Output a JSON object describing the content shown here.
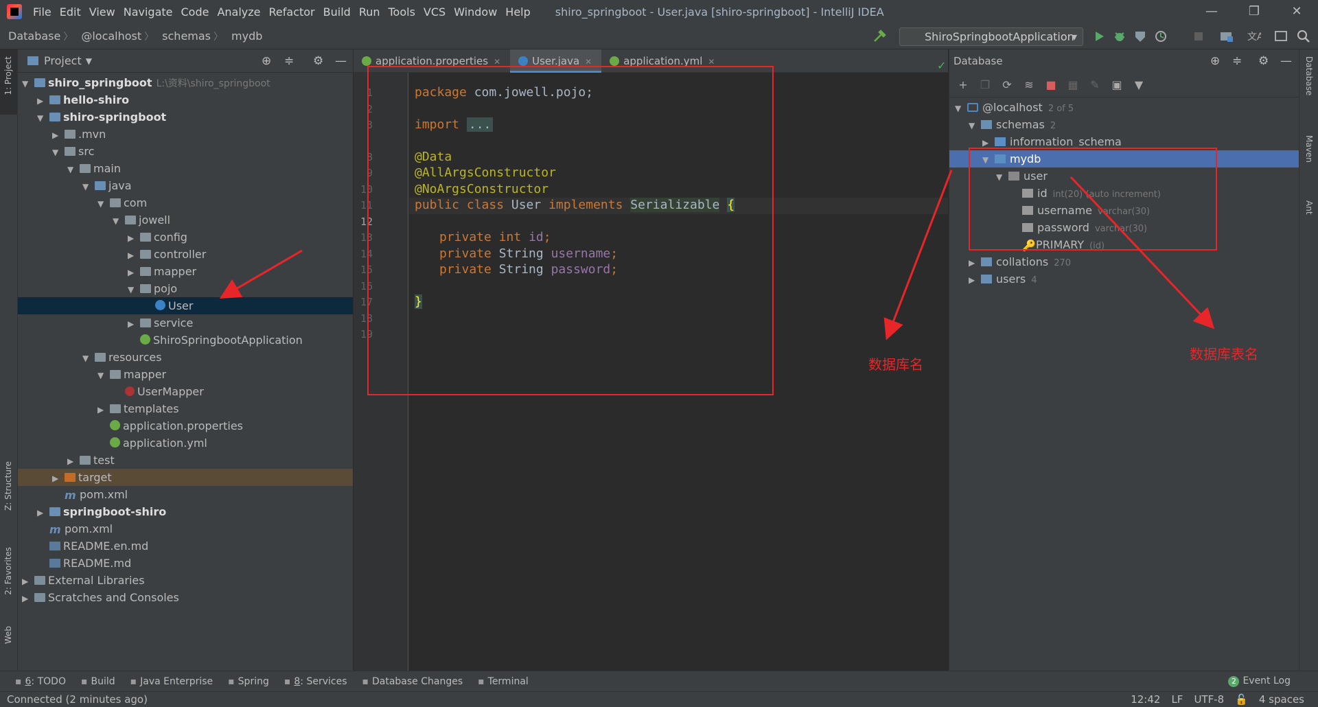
{
  "menubar": {
    "items": [
      "File",
      "Edit",
      "View",
      "Navigate",
      "Code",
      "Analyze",
      "Refactor",
      "Build",
      "Run",
      "Tools",
      "VCS",
      "Window",
      "Help"
    ],
    "window_title": "shiro_springboot - User.java [shiro-springboot] - IntelliJ IDEA",
    "window_controls": [
      "minimize-icon",
      "restore-icon",
      "close-icon"
    ]
  },
  "breadcrumb": [
    "Database",
    "@localhost",
    "schemas",
    "mydb"
  ],
  "run_config": "ShiroSpringbootApplication",
  "left_stripe": {
    "project": "1: Project",
    "structure": "Z: Structure",
    "favorites": "2: Favorites",
    "web": "Web"
  },
  "project_panel": {
    "title": "Project",
    "tree": [
      {
        "label": "shiro_springboot",
        "note": "L:\\资料\\shiro_springboot",
        "icon": "module",
        "bold": true,
        "depth": 0,
        "arrow": "down"
      },
      {
        "label": "hello-shiro",
        "icon": "module",
        "bold": true,
        "depth": 1,
        "arrow": "right"
      },
      {
        "label": "shiro-springboot",
        "icon": "module",
        "bold": true,
        "depth": 1,
        "arrow": "down"
      },
      {
        "label": ".mvn",
        "icon": "folder",
        "depth": 2,
        "arrow": "right"
      },
      {
        "label": "src",
        "icon": "folder",
        "depth": 2,
        "arrow": "down"
      },
      {
        "label": "main",
        "icon": "folder",
        "depth": 3,
        "arrow": "down"
      },
      {
        "label": "java",
        "icon": "folder-blue",
        "depth": 4,
        "arrow": "down"
      },
      {
        "label": "com",
        "icon": "pkg",
        "depth": 5,
        "arrow": "down"
      },
      {
        "label": "jowell",
        "icon": "pkg",
        "depth": 6,
        "arrow": "down"
      },
      {
        "label": "config",
        "icon": "pkg",
        "depth": 7,
        "arrow": "right"
      },
      {
        "label": "controller",
        "icon": "pkg",
        "depth": 7,
        "arrow": "right"
      },
      {
        "label": "mapper",
        "icon": "pkg",
        "depth": 7,
        "arrow": "right"
      },
      {
        "label": "pojo",
        "icon": "pkg",
        "depth": 7,
        "arrow": "down"
      },
      {
        "label": "User",
        "icon": "class",
        "depth": 8,
        "arrow": "",
        "selected": true
      },
      {
        "label": "service",
        "icon": "pkg",
        "depth": 7,
        "arrow": "right"
      },
      {
        "label": "ShiroSpringbootApplication",
        "icon": "spring",
        "depth": 7,
        "arrow": ""
      },
      {
        "label": "resources",
        "icon": "folder",
        "depth": 4,
        "arrow": "down"
      },
      {
        "label": "mapper",
        "icon": "folder",
        "depth": 5,
        "arrow": "down"
      },
      {
        "label": "UserMapper",
        "icon": "mybatis",
        "depth": 6,
        "arrow": ""
      },
      {
        "label": "templates",
        "icon": "folder",
        "depth": 5,
        "arrow": "right"
      },
      {
        "label": "application.properties",
        "icon": "spring",
        "depth": 5,
        "arrow": ""
      },
      {
        "label": "application.yml",
        "icon": "spring",
        "depth": 5,
        "arrow": ""
      },
      {
        "label": "test",
        "icon": "folder",
        "depth": 3,
        "arrow": "right"
      },
      {
        "label": "target",
        "icon": "folder-orange",
        "depth": 2,
        "arrow": "right",
        "highlight": true
      },
      {
        "label": "pom.xml",
        "icon": "maven",
        "depth": 2,
        "arrow": ""
      },
      {
        "label": "springboot-shiro",
        "icon": "module",
        "bold": true,
        "depth": 1,
        "arrow": "right"
      },
      {
        "label": "pom.xml",
        "icon": "maven",
        "depth": 1,
        "arrow": ""
      },
      {
        "label": "README.en.md",
        "icon": "md",
        "depth": 1,
        "arrow": ""
      },
      {
        "label": "README.md",
        "icon": "md",
        "depth": 1,
        "arrow": ""
      },
      {
        "label": "External Libraries",
        "icon": "lib",
        "depth": 0,
        "arrow": "right"
      },
      {
        "label": "Scratches and Consoles",
        "icon": "lib",
        "depth": 0,
        "arrow": "right"
      }
    ]
  },
  "editor": {
    "tabs": [
      {
        "label": "application.properties",
        "active": false
      },
      {
        "label": "User.java",
        "active": true
      },
      {
        "label": "application.yml",
        "active": false
      }
    ],
    "line_numbers": [
      "1",
      "2",
      "3",
      "8",
      "9",
      "10",
      "11",
      "12",
      "13",
      "14",
      "15",
      "16",
      "17",
      "18",
      "19"
    ],
    "current_line": "12",
    "code": {
      "l1_kw": "package",
      "l1_rest": " com.jowell.pojo;",
      "l3_kw": "import",
      "l3_fold": "...",
      "l9": "@Data",
      "l10": "@AllArgsConstructor",
      "l11": "@NoArgsConstructor",
      "l12_kw1": "public class",
      "l12_name": " User ",
      "l12_kw2": "implements",
      "l12_iface": "Serializable",
      "l12_brace": "{",
      "l14_kw": "private int",
      "l14_fld": "id",
      "l15_kw": "private",
      "l15_type": " String ",
      "l15_fld": "username",
      "l16_kw": "private",
      "l16_type": " String ",
      "l16_fld": "password",
      "semi": ";",
      "l18": "}"
    }
  },
  "database_panel": {
    "title": "Database",
    "tree": [
      {
        "label": "@localhost",
        "note": "2 of 5",
        "icon": "host",
        "arrow": "down"
      },
      {
        "label": "schemas",
        "note": "2",
        "icon": "folder-blue",
        "arrow": "down"
      },
      {
        "label": "information_schema",
        "note": "",
        "icon": "schema",
        "arrow": "right"
      },
      {
        "label": "mydb",
        "note": "",
        "icon": "schema",
        "arrow": "down",
        "selected": true
      },
      {
        "label": "user",
        "note": "",
        "icon": "table",
        "arrow": "down"
      },
      {
        "label": "id",
        "note": "int(20) (auto increment)",
        "icon": "col",
        "arrow": ""
      },
      {
        "label": "username",
        "note": "varchar(30)",
        "icon": "col",
        "arrow": ""
      },
      {
        "label": "password",
        "note": "varchar(30)",
        "icon": "col",
        "arrow": ""
      },
      {
        "label": "PRIMARY",
        "note": "(id)",
        "icon": "key",
        "arrow": ""
      },
      {
        "label": "collations",
        "note": "270",
        "icon": "folder-blue",
        "arrow": "right"
      },
      {
        "label": "users",
        "note": "4",
        "icon": "folder-blue",
        "arrow": "right"
      }
    ]
  },
  "right_stripe": {
    "database": "Database",
    "maven": "Maven",
    "ant": "Ant"
  },
  "annotations": {
    "db_name": "数据库名",
    "table_name": "数据库表名"
  },
  "tool_windows": [
    {
      "num": "6",
      "label": ": TODO"
    },
    {
      "num": "",
      "label": "Build"
    },
    {
      "num": "",
      "label": "Java Enterprise"
    },
    {
      "num": "",
      "label": "Spring"
    },
    {
      "num": "8",
      "label": ": Services"
    },
    {
      "num": "",
      "label": "Database Changes"
    },
    {
      "num": "",
      "label": "Terminal"
    }
  ],
  "event_log": {
    "count": "2",
    "label": "Event Log"
  },
  "status": {
    "left": "Connected (2 minutes ago)",
    "position": "12:42",
    "line_sep": "LF",
    "encoding": "UTF-8",
    "indent": "4 spaces"
  },
  "colors": {
    "accent": "#4b6eaf",
    "annotation_red": "#e8262a"
  }
}
